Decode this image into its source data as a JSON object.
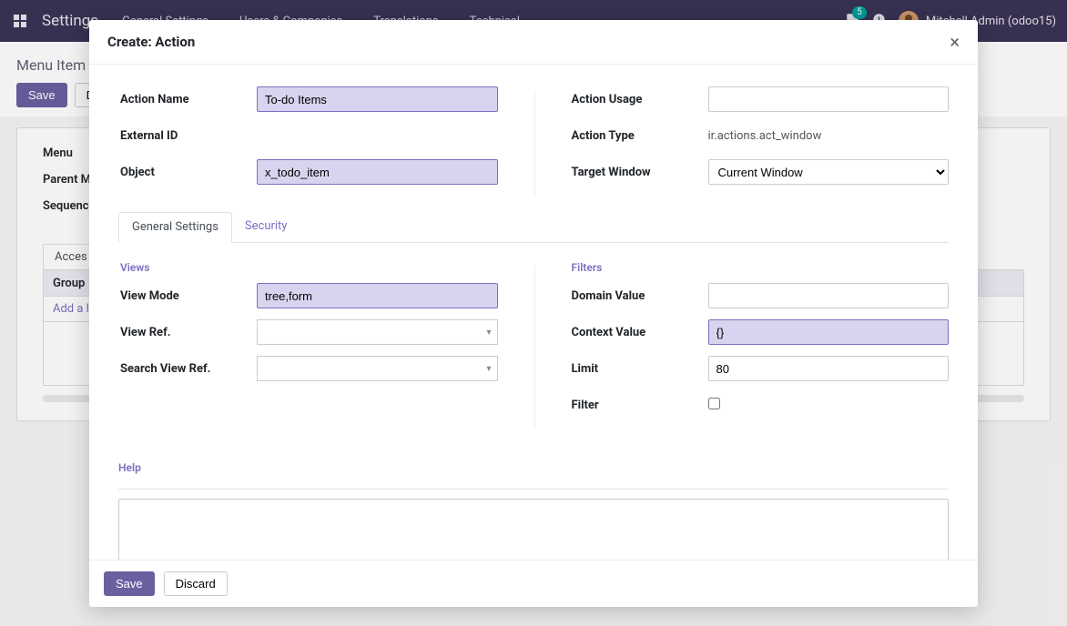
{
  "topbar": {
    "app_title": "Settings",
    "nav": [
      "General Settings",
      "Users & Companies",
      "Translations",
      "Technical"
    ],
    "notif_count": "5",
    "user_name": "Mitchell Admin (odoo15)"
  },
  "controlbar": {
    "breadcrumb": "Menu Item",
    "save": "Save",
    "discard_prefix": "Dis"
  },
  "bgform": {
    "menu": "Menu",
    "parent_menu": "Parent M",
    "sequence": "Sequenc",
    "tab_access": "Acces",
    "group_header": "Group",
    "add_line": "Add a li"
  },
  "modal": {
    "title": "Create: Action",
    "fields": {
      "action_name_label": "Action Name",
      "action_name_value": "To-do Items",
      "external_id_label": "External ID",
      "object_label": "Object",
      "object_value": "x_todo_item",
      "action_usage_label": "Action Usage",
      "action_type_label": "Action Type",
      "action_type_value": "ir.actions.act_window",
      "target_window_label": "Target Window",
      "target_window_value": "Current Window"
    },
    "tabs": {
      "general": "General Settings",
      "security": "Security"
    },
    "views": {
      "section": "Views",
      "view_mode_label": "View Mode",
      "view_mode_value": "tree,form",
      "view_ref_label": "View Ref.",
      "search_view_ref_label": "Search View Ref."
    },
    "filters": {
      "section": "Filters",
      "domain_label": "Domain Value",
      "context_label": "Context Value",
      "context_value": "{}",
      "limit_label": "Limit",
      "limit_value": "80",
      "filter_label": "Filter"
    },
    "help_section": "Help",
    "footer": {
      "save": "Save",
      "discard": "Discard"
    }
  }
}
